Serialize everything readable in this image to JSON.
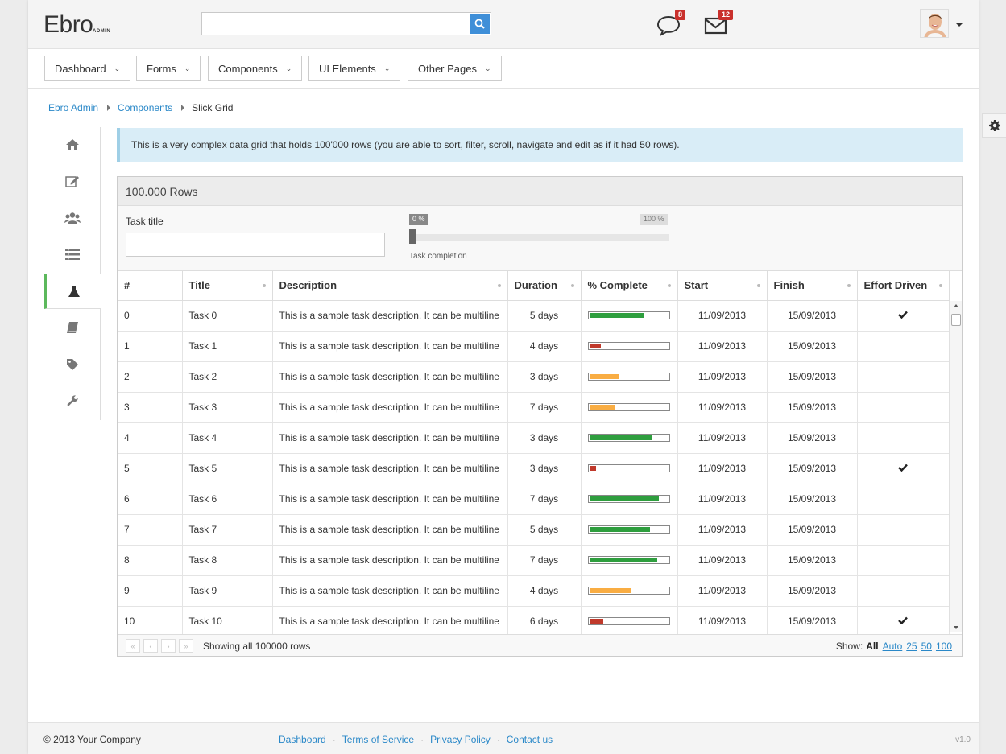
{
  "header": {
    "logo": "Ebro",
    "logo_sub": "ADMIN",
    "search_placeholder": "",
    "messages_badge": "8",
    "mail_badge": "12"
  },
  "nav": {
    "items": [
      {
        "label": "Dashboard"
      },
      {
        "label": "Forms"
      },
      {
        "label": "Components"
      },
      {
        "label": "UI Elements"
      },
      {
        "label": "Other Pages"
      }
    ]
  },
  "breadcrumb": {
    "items": [
      "Ebro Admin",
      "Components",
      "Slick Grid"
    ]
  },
  "sidebar": {
    "icons": [
      "home-icon",
      "edit-icon",
      "users-icon",
      "list-icon",
      "flask-icon",
      "book-icon",
      "tag-icon",
      "wrench-icon"
    ],
    "active_index": 4
  },
  "alert": {
    "text": "This is a very complex data grid that holds 100'000 rows (you are able to sort, filter, scroll, navigate and edit as if it had 50 rows)."
  },
  "grid": {
    "title": "100.000 Rows",
    "filter_label": "Task title",
    "filter_value": "",
    "slider": {
      "min_label": "0 %",
      "max_label": "100 %",
      "caption": "Task completion",
      "value_percent": 0
    },
    "columns": [
      "#",
      "Title",
      "Description",
      "Duration",
      "% Complete",
      "Start",
      "Finish",
      "Effort Driven"
    ],
    "rows": [
      {
        "id": "0",
        "title": "Task 0",
        "desc": "This is a sample task description. It can be multiline",
        "duration": "5 days",
        "pct": 70,
        "start": "11/09/2013",
        "finish": "15/09/2013",
        "effort": true
      },
      {
        "id": "1",
        "title": "Task 1",
        "desc": "This is a sample task description. It can be multiline",
        "duration": "4 days",
        "pct": 15,
        "start": "11/09/2013",
        "finish": "15/09/2013",
        "effort": false
      },
      {
        "id": "2",
        "title": "Task 2",
        "desc": "This is a sample task description. It can be multiline",
        "duration": "3 days",
        "pct": 38,
        "start": "11/09/2013",
        "finish": "15/09/2013",
        "effort": false
      },
      {
        "id": "3",
        "title": "Task 3",
        "desc": "This is a sample task description. It can be multiline",
        "duration": "7 days",
        "pct": 33,
        "start": "11/09/2013",
        "finish": "15/09/2013",
        "effort": false
      },
      {
        "id": "4",
        "title": "Task 4",
        "desc": "This is a sample task description. It can be multiline",
        "duration": "3 days",
        "pct": 79,
        "start": "11/09/2013",
        "finish": "15/09/2013",
        "effort": false
      },
      {
        "id": "5",
        "title": "Task 5",
        "desc": "This is a sample task description. It can be multiline",
        "duration": "3 days",
        "pct": 9,
        "start": "11/09/2013",
        "finish": "15/09/2013",
        "effort": true
      },
      {
        "id": "6",
        "title": "Task 6",
        "desc": "This is a sample task description. It can be multiline",
        "duration": "7 days",
        "pct": 88,
        "start": "11/09/2013",
        "finish": "15/09/2013",
        "effort": false
      },
      {
        "id": "7",
        "title": "Task 7",
        "desc": "This is a sample task description. It can be multiline",
        "duration": "5 days",
        "pct": 77,
        "start": "11/09/2013",
        "finish": "15/09/2013",
        "effort": false
      },
      {
        "id": "8",
        "title": "Task 8",
        "desc": "This is a sample task description. It can be multiline",
        "duration": "7 days",
        "pct": 86,
        "start": "11/09/2013",
        "finish": "15/09/2013",
        "effort": false
      },
      {
        "id": "9",
        "title": "Task 9",
        "desc": "This is a sample task description. It can be multiline",
        "duration": "4 days",
        "pct": 53,
        "start": "11/09/2013",
        "finish": "15/09/2013",
        "effort": false
      },
      {
        "id": "10",
        "title": "Task 10",
        "desc": "This is a sample task description. It can be multiline",
        "duration": "6 days",
        "pct": 18,
        "start": "11/09/2013",
        "finish": "15/09/2013",
        "effort": true
      }
    ],
    "pager_text": "Showing all 100000 rows",
    "show_label": "Show:",
    "show_options": [
      "All",
      "Auto",
      "25",
      "50",
      "100"
    ],
    "show_selected": "All"
  },
  "footer": {
    "copyright": "© 2013 Your Company",
    "links": [
      "Dashboard",
      "Terms of Service",
      "Privacy Policy",
      "Contact us"
    ],
    "version": "v1.0"
  },
  "colors": {
    "accent": "#2a88c8",
    "progress_high": "#2e9e3e",
    "progress_mid": "#f9ad43",
    "progress_low": "#c0392b",
    "sidebar_active": "#5cb85c",
    "alert_bg": "#d9edf7"
  }
}
